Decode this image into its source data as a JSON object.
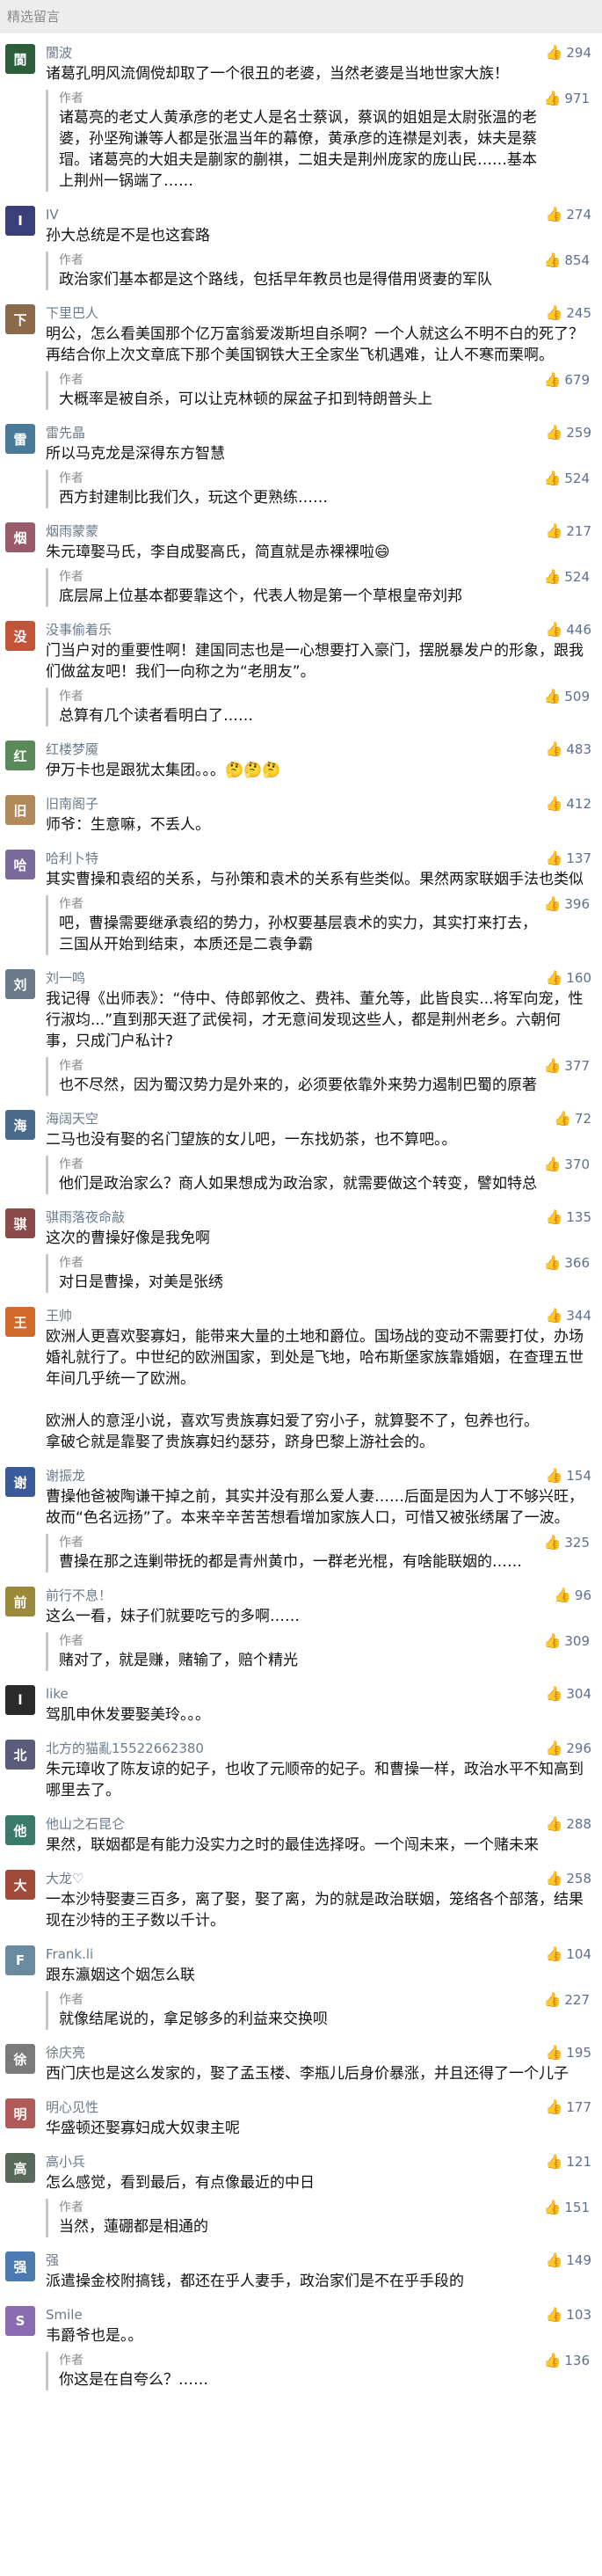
{
  "header": {
    "title": "精选留言"
  },
  "colors": {
    "like": "#5c7090",
    "name": "#6a7a8a"
  },
  "icons": {
    "like": "thumbs-up-icon"
  },
  "comments": [
    {
      "name": "閬波",
      "likes": "294",
      "text": "诸葛孔明风流倜傥却取了一个很丑的老婆，当然老婆是当地世家大族！",
      "reply": {
        "author": "作者",
        "likes": "971",
        "text": "诸葛亮的老丈人黄承彦的老丈人是名士蔡讽，蔡讽的姐姐是太尉张温的老婆，孙坚殉谦等人都是张温当年的幕僚，黄承彦的连襟是刘表，妹夫是蔡瑁。诸葛亮的大姐夫是蒯家的蒯祺，二姐夫是荆州庞家的庞山民……基本上荆州一锅端了……"
      },
      "color": "#2c5e3a"
    },
    {
      "name": "IV",
      "likes": "274",
      "text": "孙大总统是不是也这套路",
      "reply": {
        "author": "作者",
        "likes": "854",
        "text": "政治家们基本都是这个路线，包括早年教员也是得借用贤妻的军队"
      },
      "color": "#3a3f7a"
    },
    {
      "name": "下里巴人",
      "likes": "245",
      "text": "明公，怎么看美国那个亿万富翁爱泼斯坦自杀啊？一个人就这么不明不白的死了？再结合你上次文章底下那个美国钢铁大王全家坐飞机遇难，让人不寒而栗啊。",
      "reply": {
        "author": "作者",
        "likes": "679",
        "text": "大概率是被自杀，可以让克林顿的屎盆子扣到特朗普头上"
      },
      "color": "#8a6a4a"
    },
    {
      "name": "雷先晶",
      "likes": "259",
      "text": "所以马克龙是深得东方智慧",
      "reply": {
        "author": "作者",
        "likes": "524",
        "text": "西方封建制比我们久，玩这个更熟练……"
      },
      "color": "#4a7a9a"
    },
    {
      "name": "烟雨蒙蒙",
      "likes": "217",
      "text": "朱元璋娶马氏，李自成娶高氏，简直就是赤裸裸啦😄",
      "reply": {
        "author": "作者",
        "likes": "524",
        "text": "底层屌上位基本都要靠这个，代表人物是第一个草根皇帝刘邦"
      },
      "color": "#9a5a6a"
    },
    {
      "name": "没事偷着乐",
      "likes": "446",
      "text": "门当户对的重要性啊！建国同志也是一心想要打入豪门，摆脱暴发户的形象，跟我们做盆友吧！我们一向称之为“老朋友”。",
      "reply": {
        "author": "作者",
        "likes": "509",
        "text": "总算有几个读者看明白了……"
      },
      "color": "#c0553a"
    },
    {
      "name": "红楼梦魇",
      "likes": "483",
      "text": "伊万卡也是跟犹太集团。。。🤔🤔🤔",
      "reply": null,
      "color": "#5a8a5a"
    },
    {
      "name": "旧南阁子",
      "likes": "412",
      "text": "师爷：生意嘛，不丢人。",
      "reply": null,
      "color": "#b08a5a"
    },
    {
      "name": "哈利卜特",
      "likes": "137",
      "text": "其实曹操和袁绍的关系，与孙策和袁术的关系有些类似。果然两家联姻手法也类似",
      "reply": {
        "author": "作者",
        "likes": "396",
        "text": "吧，曹操需要继承袁绍的势力，孙权要基层袁术的实力，其实打来打去，三国从开始到结束，本质还是二袁争霸"
      },
      "color": "#7a6a9a"
    },
    {
      "name": "刘一鸣",
      "likes": "160",
      "text": "我记得《出师表》：“侍中、侍郎郭攸之、费祎、董允等，此皆良实...将军向宠，性行淑均...”直到那天逛了武侯祠，才无意间发现这些人，都是荆州老乡。六朝何事，只成门户私计?",
      "reply": {
        "author": "作者",
        "likes": "377",
        "text": "也不尽然，因为蜀汉势力是外来的，必须要依靠外来势力遏制巴蜀的原著"
      },
      "color": "#6a7a8a"
    },
    {
      "name": "海阔天空",
      "likes": "72",
      "text": "二马也没有娶的名门望族的女儿吧，一东找奶茶，也不算吧。。",
      "reply": {
        "author": "作者",
        "likes": "370",
        "text": "他们是政治家么？商人如果想成为政治家，就需要做这个转变，譬如特总"
      },
      "color": "#4a6a8a"
    },
    {
      "name": "骐雨落夜命敲",
      "likes": "135",
      "text": "这次的曹操好像是我免啊",
      "reply": {
        "author": "作者",
        "likes": "366",
        "text": "对日是曹操，对美是张绣"
      },
      "color": "#8a4a4a"
    },
    {
      "name": "王帅",
      "likes": "344",
      "text": "欧洲人更喜欢娶寡妇，能带来大量的土地和爵位。国场战的变动不需要打仗，办场婚礼就行了。中世纪的欧洲国家，到处是飞地，哈布斯堡家族靠婚姻，在查理五世年间几乎统一了欧洲。\n\n欧洲人的意淫小说，喜欢写贵族寡妇爱了穷小子，就算娶不了，包养也行。\n拿破仑就是靠娶了贵族寡妇约瑟芬，跻身巴黎上游社会的。",
      "reply": null,
      "color": "#d06a2a"
    },
    {
      "name": "谢振龙",
      "likes": "154",
      "text": "曹操他爸被陶谦干掉之前，其实并没有那么爱人妻……后面是因为人丁不够兴旺，故而“色名远扬”了。本来辛辛苦苦想看增加家族人口，可惜又被张绣屠了一波。",
      "reply": {
        "author": "作者",
        "likes": "325",
        "text": "曹操在那之连剿带抚的都是青州黄巾，一群老光棍，有啥能联姻的……"
      },
      "color": "#3a5a9a"
    },
    {
      "name": "前行不息！",
      "likes": "96",
      "text": "这么一看，妹子们就要吃亏的多啊……",
      "reply": {
        "author": "作者",
        "likes": "309",
        "text": "赌对了，就是赚，赌输了，赔个精光"
      },
      "color": "#9a8a3a"
    },
    {
      "name": "like",
      "likes": "304",
      "text": "驾肌申休发要娶美玲。。。",
      "reply": null,
      "color": "#2a2a2a"
    },
    {
      "name": "北方的猫亂15522662380",
      "likes": "296",
      "text": "朱元璋收了陈友谅的妃子，也收了元顺帝的妃子。和曹操一样，政治水平不知高到哪里去了。",
      "reply": null,
      "color": "#5a5a7a"
    },
    {
      "name": "他山之石昆仑",
      "likes": "288",
      "text": "果然，联姻都是有能力没实力之时的最佳选择呀。一个闯未来，一个赌未来",
      "reply": null,
      "color": "#3a7a6a"
    },
    {
      "name": "大龙♡",
      "likes": "258",
      "text": "一本沙特娶妻三百多，离了娶，娶了离，为的就是政治联姻，笼络各个部落，结果现在沙特的王子数以千计。",
      "reply": null,
      "color": "#a04a3a"
    },
    {
      "name": "Frank.li",
      "likes": "104",
      "text": "跟东瀛姻这个姻怎么联",
      "reply": {
        "author": "作者",
        "likes": "227",
        "text": "就像结尾说的，拿足够多的利益来交换呗"
      },
      "color": "#6a8aa0"
    },
    {
      "name": "徐庆亮",
      "likes": "195",
      "text": "西门庆也是这么发家的，娶了孟玉楼、李瓶儿后身价暴涨，并且还得了一个儿子",
      "reply": null,
      "color": "#7a7a7a"
    },
    {
      "name": "明心见性",
      "likes": "177",
      "text": "华盛顿还娶寡妇成大奴隶主呢",
      "reply": null,
      "color": "#b05a5a"
    },
    {
      "name": "高小兵",
      "likes": "121",
      "text": "怎么感觉，看到最后，有点像最近的中日",
      "reply": {
        "author": "作者",
        "likes": "151",
        "text": "当然，蓮硼都是相通的"
      },
      "color": "#5a6a5a"
    },
    {
      "name": "强",
      "likes": "149",
      "text": "派遣操金校附搞钱，都还在乎人妻手，政治家们是不在乎手段的",
      "reply": null,
      "color": "#4a7ab0"
    },
    {
      "name": "Smile",
      "likes": "103",
      "text": "韦爵爷也是。。",
      "reply": {
        "author": "作者",
        "likes": "136",
        "text": "你这是在自夸么？……"
      },
      "color": "#8a6ab0"
    }
  ]
}
